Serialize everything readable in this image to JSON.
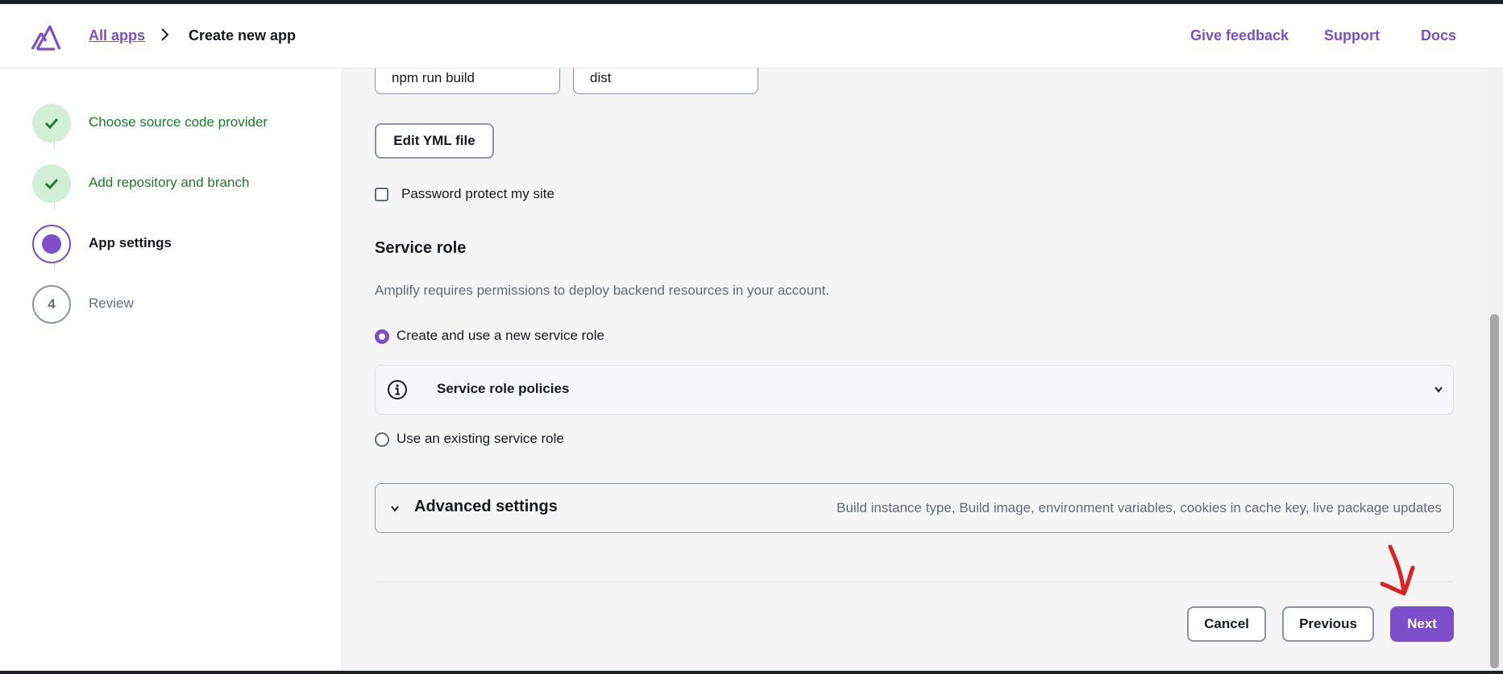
{
  "header": {
    "breadcrumb_link": "All apps",
    "breadcrumb_current": "Create new app",
    "links": [
      "Give feedback",
      "Support",
      "Docs"
    ]
  },
  "sidebar": {
    "steps": [
      {
        "label": "Choose source code provider",
        "state": "done"
      },
      {
        "label": "Add repository and branch",
        "state": "done"
      },
      {
        "label": "App settings",
        "state": "current"
      },
      {
        "label": "Review",
        "state": "todo",
        "number": "4"
      }
    ]
  },
  "build": {
    "build_command_value": "npm run build",
    "output_dir_value": "dist",
    "edit_yml_label": "Edit YML file",
    "password_protect_label": "Password protect my site"
  },
  "service_role": {
    "title": "Service role",
    "description": "Amplify requires permissions to deploy backend resources in your account.",
    "option_new": "Create and use a new service role",
    "policies_label": "Service role policies",
    "option_existing": "Use an existing service role"
  },
  "advanced": {
    "title": "Advanced settings",
    "summary": "Build instance type, Build image, environment variables, cookies in cache key, live package updates"
  },
  "footer": {
    "cancel_label": "Cancel",
    "previous_label": "Previous",
    "next_label": "Next"
  },
  "colors": {
    "accent": "#7b4fc9",
    "success": "#1b7a2a",
    "annotation": "#e02020"
  }
}
